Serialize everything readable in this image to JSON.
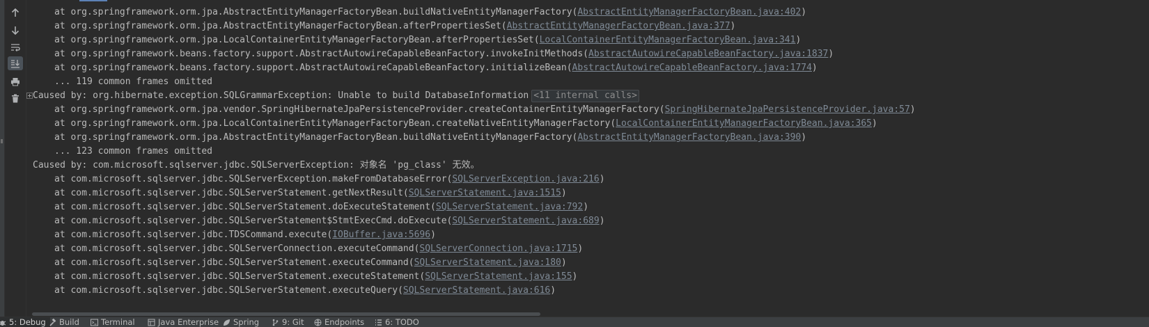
{
  "toolbar": {
    "items": [
      {
        "name": "up-arrow-icon"
      },
      {
        "name": "down-arrow-icon"
      },
      {
        "name": "soft-wrap-icon"
      },
      {
        "name": "scroll-to-end-icon",
        "active": true
      },
      {
        "name": "print-icon"
      },
      {
        "name": "trash-icon"
      }
    ]
  },
  "console": {
    "lines": [
      {
        "type": "frame",
        "prefix": "at org.springframework.orm.jpa.AbstractEntityManagerFactoryBean.buildNativeEntityManagerFactory(",
        "link": "AbstractEntityManagerFactoryBean.java:402",
        "suffix": ")"
      },
      {
        "type": "frame",
        "prefix": "at org.springframework.orm.jpa.AbstractEntityManagerFactoryBean.afterPropertiesSet(",
        "link": "AbstractEntityManagerFactoryBean.java:377",
        "suffix": ")"
      },
      {
        "type": "frame",
        "prefix": "at org.springframework.orm.jpa.LocalContainerEntityManagerFactoryBean.afterPropertiesSet(",
        "link": "LocalContainerEntityManagerFactoryBean.java:341",
        "suffix": ")"
      },
      {
        "type": "frame",
        "prefix": "at org.springframework.beans.factory.support.AbstractAutowireCapableBeanFactory.invokeInitMethods(",
        "link": "AbstractAutowireCapableBeanFactory.java:1837",
        "suffix": ")"
      },
      {
        "type": "frame",
        "prefix": "at org.springframework.beans.factory.support.AbstractAutowireCapableBeanFactory.initializeBean(",
        "link": "AbstractAutowireCapableBeanFactory.java:1774",
        "suffix": ")"
      },
      {
        "type": "omitted",
        "text": "... 119 common frames omitted"
      },
      {
        "type": "caused-fold",
        "text": "Caused by: org.hibernate.exception.SQLGrammarException: Unable to build DatabaseInformation",
        "internal": "<11 internal calls>"
      },
      {
        "type": "frame",
        "prefix": "at org.springframework.orm.jpa.vendor.SpringHibernateJpaPersistenceProvider.createContainerEntityManagerFactory(",
        "link": "SpringHibernateJpaPersistenceProvider.java:57",
        "suffix": ")"
      },
      {
        "type": "frame",
        "prefix": "at org.springframework.orm.jpa.LocalContainerEntityManagerFactoryBean.createNativeEntityManagerFactory(",
        "link": "LocalContainerEntityManagerFactoryBean.java:365",
        "suffix": ")"
      },
      {
        "type": "frame",
        "prefix": "at org.springframework.orm.jpa.AbstractEntityManagerFactoryBean.buildNativeEntityManagerFactory(",
        "link": "AbstractEntityManagerFactoryBean.java:390",
        "suffix": ")"
      },
      {
        "type": "omitted",
        "text": "... 123 common frames omitted"
      },
      {
        "type": "caused",
        "text": "Caused by: com.microsoft.sqlserver.jdbc.SQLServerException: 对象名 'pg_class' 无效。"
      },
      {
        "type": "frame",
        "prefix": "at com.microsoft.sqlserver.jdbc.SQLServerException.makeFromDatabaseError(",
        "link": "SQLServerException.java:216",
        "suffix": ")"
      },
      {
        "type": "frame",
        "prefix": "at com.microsoft.sqlserver.jdbc.SQLServerStatement.getNextResult(",
        "link": "SQLServerStatement.java:1515",
        "suffix": ")"
      },
      {
        "type": "frame",
        "prefix": "at com.microsoft.sqlserver.jdbc.SQLServerStatement.doExecuteStatement(",
        "link": "SQLServerStatement.java:792",
        "suffix": ")"
      },
      {
        "type": "frame",
        "prefix": "at com.microsoft.sqlserver.jdbc.SQLServerStatement$StmtExecCmd.doExecute(",
        "link": "SQLServerStatement.java:689",
        "suffix": ")"
      },
      {
        "type": "frame",
        "prefix": "at com.microsoft.sqlserver.jdbc.TDSCommand.execute(",
        "link": "IOBuffer.java:5696",
        "suffix": ")"
      },
      {
        "type": "frame",
        "prefix": "at com.microsoft.sqlserver.jdbc.SQLServerConnection.executeCommand(",
        "link": "SQLServerConnection.java:1715",
        "suffix": ")"
      },
      {
        "type": "frame",
        "prefix": "at com.microsoft.sqlserver.jdbc.SQLServerStatement.executeCommand(",
        "link": "SQLServerStatement.java:180",
        "suffix": ")"
      },
      {
        "type": "frame",
        "prefix": "at com.microsoft.sqlserver.jdbc.SQLServerStatement.executeStatement(",
        "link": "SQLServerStatement.java:155",
        "suffix": ")"
      },
      {
        "type": "frame",
        "prefix": "at com.microsoft.sqlserver.jdbc.SQLServerStatement.executeQuery(",
        "link": "SQLServerStatement.java:616",
        "suffix": ")"
      }
    ]
  },
  "bottom_bar": {
    "tabs": [
      {
        "label": "5: Debug",
        "icon": "bug-icon",
        "selected": true
      },
      {
        "label": "Build",
        "icon": "hammer-icon"
      },
      {
        "label": "Terminal",
        "icon": "terminal-icon"
      },
      {
        "label": "Java Enterprise",
        "icon": "java-enterprise-icon"
      },
      {
        "label": "Spring",
        "icon": "spring-leaf-icon"
      },
      {
        "label": "9: Git",
        "icon": "git-branch-icon"
      },
      {
        "label": "Endpoints",
        "icon": "globe-icon"
      },
      {
        "label": "6: TODO",
        "icon": "list-icon"
      }
    ]
  },
  "colors": {
    "background": "#2b2b2b",
    "text": "#bababa",
    "link": "#7f8a96",
    "toolbar_bg": "#3c3f41"
  }
}
